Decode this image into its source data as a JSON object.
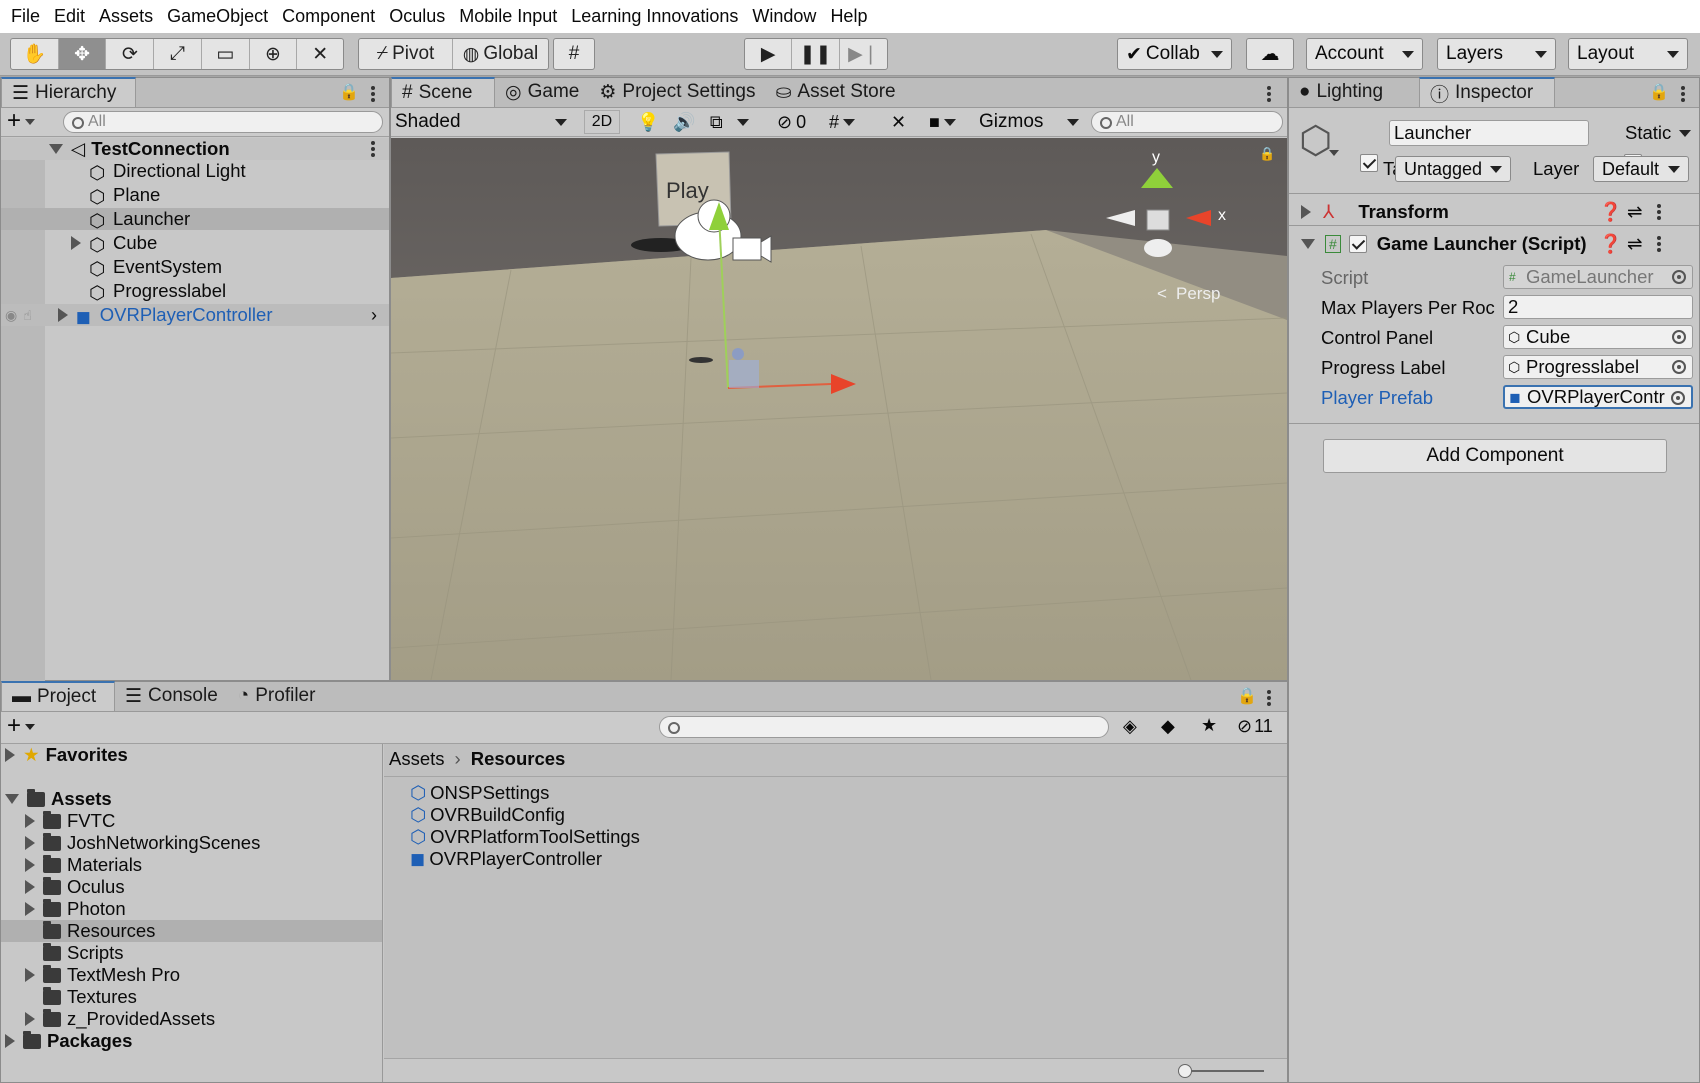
{
  "menu": [
    "File",
    "Edit",
    "Assets",
    "GameObject",
    "Component",
    "Oculus",
    "Mobile Input",
    "Learning Innovations",
    "Window",
    "Help"
  ],
  "toolbar": {
    "pivot": "Pivot",
    "global": "Global",
    "collab": "Collab",
    "account": "Account",
    "layers": "Layers",
    "layout": "Layout"
  },
  "hierarchy": {
    "tab": "Hierarchy",
    "search_placeholder": "All",
    "scene": "TestConnection",
    "items": [
      "Directional Light",
      "Plane",
      "Launcher",
      "Cube",
      "EventSystem",
      "Progresslabel",
      "OVRPlayerController"
    ]
  },
  "scene_view": {
    "tabs": [
      "Scene",
      "Game",
      "Project Settings",
      "Asset Store"
    ],
    "shading": "Shaded",
    "mode_2d": "2D",
    "hidden_count": "0",
    "gizmos": "Gizmos",
    "search_placeholder": "All",
    "play_label": "Play",
    "persp": "Persp",
    "axis_y": "y",
    "axis_x": "x"
  },
  "inspector": {
    "tabs": [
      "Lighting",
      "Inspector"
    ],
    "object_name": "Launcher",
    "static_label": "Static",
    "tag_label": "Tag",
    "tag_value": "Untagged",
    "layer_label": "Layer",
    "layer_value": "Default",
    "transform": "Transform",
    "component": "Game Launcher (Script)",
    "fields": [
      {
        "label": "Script",
        "value": "GameLauncher"
      },
      {
        "label": "Max Players Per Roc",
        "value": "2"
      },
      {
        "label": "Control Panel",
        "value": "Cube"
      },
      {
        "label": "Progress Label",
        "value": "Progresslabel"
      },
      {
        "label": "Player Prefab",
        "value": "OVRPlayerContr"
      }
    ],
    "add_component": "Add Component"
  },
  "project": {
    "tabs": [
      "Project",
      "Console",
      "Profiler"
    ],
    "hidden_count": "11",
    "favorites": "Favorites",
    "assets": "Assets",
    "folders": [
      "FVTC",
      "JoshNetworkingScenes",
      "Materials",
      "Oculus",
      "Photon",
      "Resources",
      "Scripts",
      "TextMesh Pro",
      "Textures",
      "z_ProvidedAssets"
    ],
    "packages": "Packages",
    "breadcrumb_root": "Assets",
    "breadcrumb_current": "Resources",
    "files": [
      "ONSPSettings",
      "OVRBuildConfig",
      "OVRPlatformToolSettings",
      "OVRPlayerController"
    ]
  },
  "colors": {
    "accent": "#3a72b0",
    "selected_row": "#b0b0b0",
    "prefab_blue": "#1e5fb5"
  }
}
